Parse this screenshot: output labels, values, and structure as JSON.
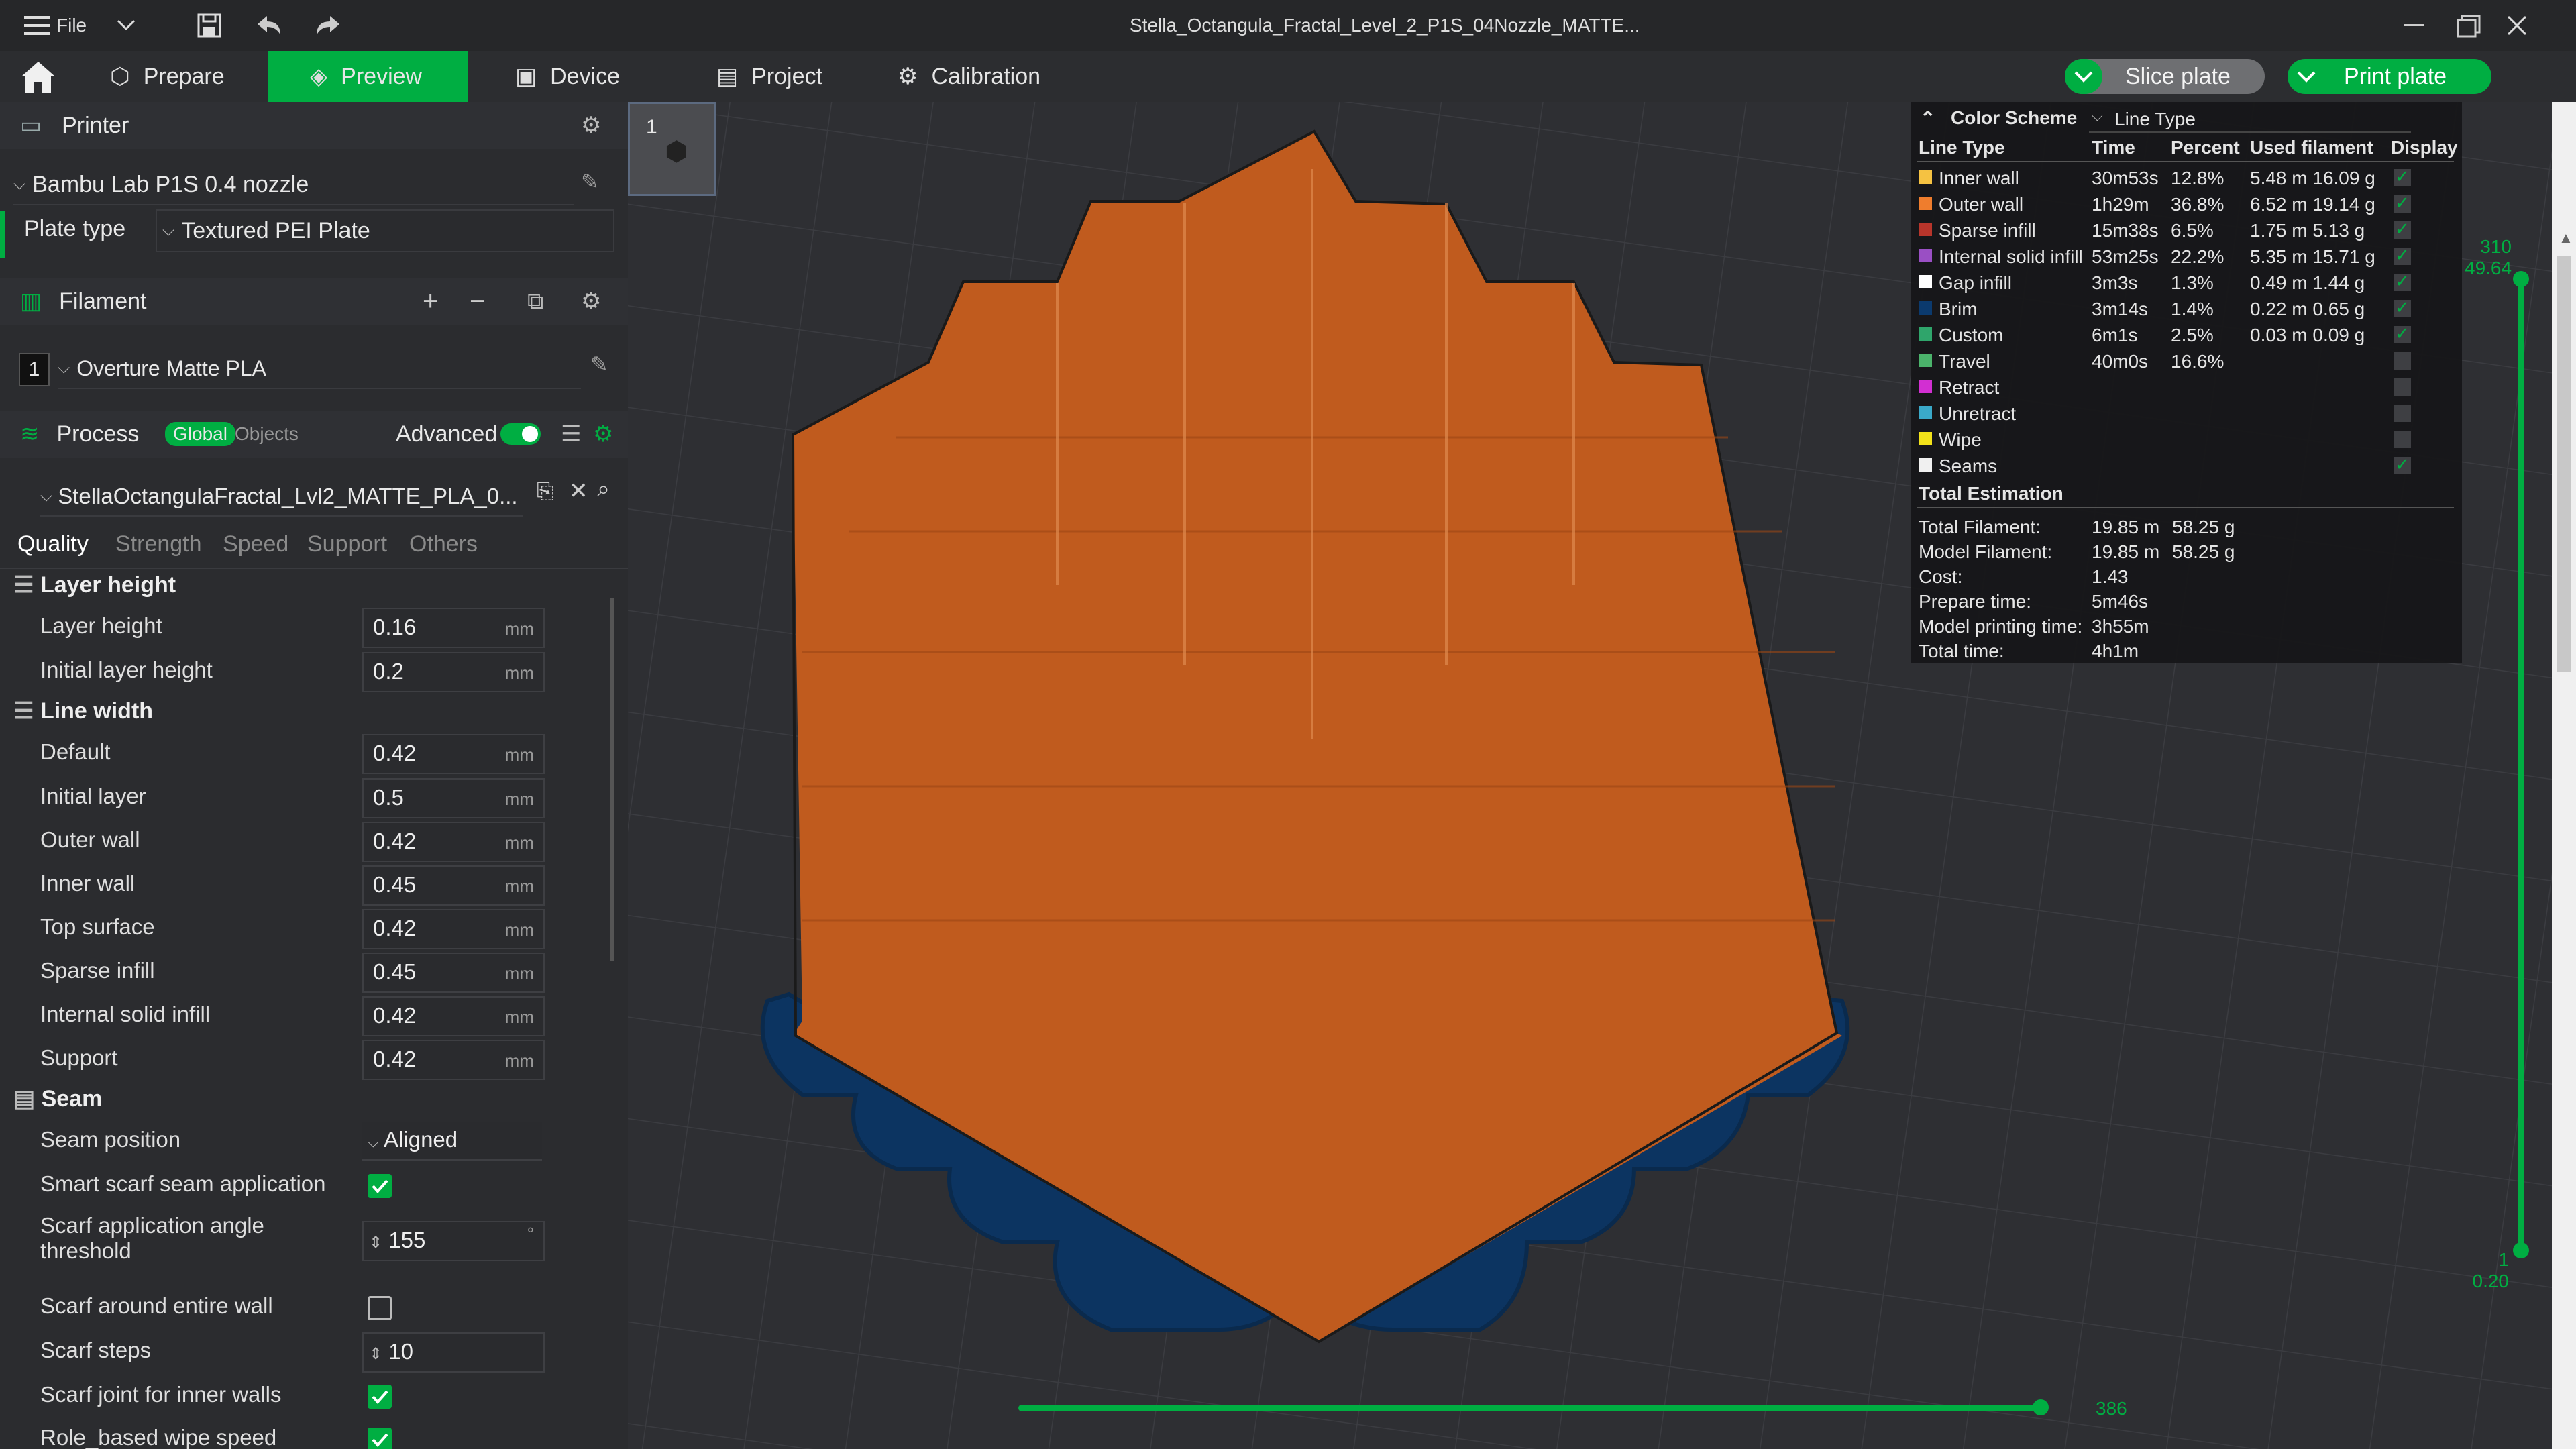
{
  "titlebar": {
    "file_label": "File",
    "window_title": "Stella_Octangula_Fractal_Level_2_P1S_04Nozzle_MATTE..."
  },
  "nav": {
    "tabs": [
      "Prepare",
      "Preview",
      "Device",
      "Project",
      "Calibration"
    ],
    "slice_plate": "Slice plate",
    "print_plate": "Print plate"
  },
  "printer": {
    "section_title": "Printer",
    "name": "Bambu Lab P1S 0.4 nozzle",
    "plate_type_label": "Plate type",
    "plate_type_value": "Textured PEI Plate"
  },
  "filament": {
    "section_title": "Filament",
    "slot": "1",
    "name": "Overture Matte PLA"
  },
  "process": {
    "section_title": "Process",
    "global_label": "Global",
    "objects_label": "Objects",
    "advanced_label": "Advanced",
    "profile_name": "StellaOctangulaFractal_Lvl2_MATTE_PLA_0...",
    "tabs": [
      "Quality",
      "Strength",
      "Speed",
      "Support",
      "Others"
    ]
  },
  "settings": {
    "layer_height_group": "Layer height",
    "layer_height": {
      "label": "Layer height",
      "value": "0.16",
      "unit": "mm"
    },
    "initial_layer_height": {
      "label": "Initial layer height",
      "value": "0.2",
      "unit": "mm"
    },
    "line_width_group": "Line width",
    "default": {
      "label": "Default",
      "value": "0.42",
      "unit": "mm"
    },
    "initial_layer": {
      "label": "Initial layer",
      "value": "0.5",
      "unit": "mm"
    },
    "outer_wall": {
      "label": "Outer wall",
      "value": "0.42",
      "unit": "mm"
    },
    "inner_wall": {
      "label": "Inner wall",
      "value": "0.45",
      "unit": "mm"
    },
    "top_surface": {
      "label": "Top surface",
      "value": "0.42",
      "unit": "mm"
    },
    "sparse_infill": {
      "label": "Sparse infill",
      "value": "0.45",
      "unit": "mm"
    },
    "internal_solid_infill": {
      "label": "Internal solid infill",
      "value": "0.42",
      "unit": "mm"
    },
    "support": {
      "label": "Support",
      "value": "0.42",
      "unit": "mm"
    },
    "seam_group": "Seam",
    "seam_position": {
      "label": "Seam position",
      "value": "Aligned"
    },
    "smart_scarf": {
      "label": "Smart scarf seam application",
      "checked": true
    },
    "scarf_angle_line1": "Scarf application angle",
    "scarf_angle_line2": "threshold",
    "scarf_angle_value": "155",
    "scarf_angle_unit": "°",
    "scarf_entire_wall": {
      "label": "Scarf around entire wall",
      "checked": false
    },
    "scarf_steps": {
      "label": "Scarf steps",
      "value": "10"
    },
    "scarf_inner_walls": {
      "label": "Scarf joint for inner walls",
      "checked": true
    },
    "role_based_wipe": {
      "label": "Role_based wipe speed",
      "checked": true
    }
  },
  "plate_thumb": {
    "label": "1"
  },
  "legend": {
    "color_scheme_label": "Color Scheme",
    "scheme_value": "Line Type",
    "headers": [
      "Line Type",
      "Time",
      "Percent",
      "Used filament",
      "Display"
    ],
    "rows": [
      {
        "name": "Inner wall",
        "time": "30m53s",
        "percent": "12.8%",
        "used": "5.48 m  16.09 g",
        "color": "#f5c242",
        "display": true
      },
      {
        "name": "Outer wall",
        "time": "1h29m",
        "percent": "36.8%",
        "used": "6.52 m  19.14 g",
        "color": "#ef7d2d",
        "display": true
      },
      {
        "name": "Sparse infill",
        "time": "15m38s",
        "percent": "6.5%",
        "used": "1.75 m  5.13 g",
        "color": "#b8352b",
        "display": true
      },
      {
        "name": "Internal solid infill",
        "time": "53m25s",
        "percent": "22.2%",
        "used": "5.35 m  15.71 g",
        "color": "#9a4fc4",
        "display": true
      },
      {
        "name": "Gap infill",
        "time": "3m3s",
        "percent": "1.3%",
        "used": "0.49 m  1.44 g",
        "color": "#ffffff",
        "display": true
      },
      {
        "name": "Brim",
        "time": "3m14s",
        "percent": "1.4%",
        "used": "0.22 m  0.65 g",
        "color": "#0b3a6e",
        "display": true
      },
      {
        "name": "Custom",
        "time": "6m1s",
        "percent": "2.5%",
        "used": "0.03 m  0.09 g",
        "color": "#2fa56b",
        "display": true
      },
      {
        "name": "Travel",
        "time": "40m0s",
        "percent": "16.6%",
        "used": "",
        "color": "#4bb36b",
        "display": false
      },
      {
        "name": "Retract",
        "time": "",
        "percent": "",
        "used": "",
        "color": "#d22fd2",
        "display": false
      },
      {
        "name": "Unretract",
        "time": "",
        "percent": "",
        "used": "",
        "color": "#3aa9c9",
        "display": false
      },
      {
        "name": "Wipe",
        "time": "",
        "percent": "",
        "used": "",
        "color": "#f2e21a",
        "display": false
      },
      {
        "name": "Seams",
        "time": "",
        "percent": "",
        "used": "",
        "color": "#f0f0f0",
        "display": true
      }
    ],
    "total_title": "Total Estimation",
    "totals": [
      {
        "label": "Total Filament:",
        "v1": "19.85 m",
        "v2": "58.25 g"
      },
      {
        "label": "Model Filament:",
        "v1": "19.85 m",
        "v2": "58.25 g"
      },
      {
        "label": "Cost:",
        "v1": "1.43",
        "v2": ""
      },
      {
        "label": "Prepare time:",
        "v1": "5m46s",
        "v2": ""
      },
      {
        "label": "Model printing time:",
        "v1": "3h55m",
        "v2": ""
      },
      {
        "label": "Total time:",
        "v1": "4h1m",
        "v2": ""
      }
    ]
  },
  "layer_slider": {
    "top_layer": "310",
    "top_height": "49.64",
    "bottom_layer": "1",
    "bottom_height": "0.20"
  },
  "move_slider": {
    "value": "386"
  }
}
